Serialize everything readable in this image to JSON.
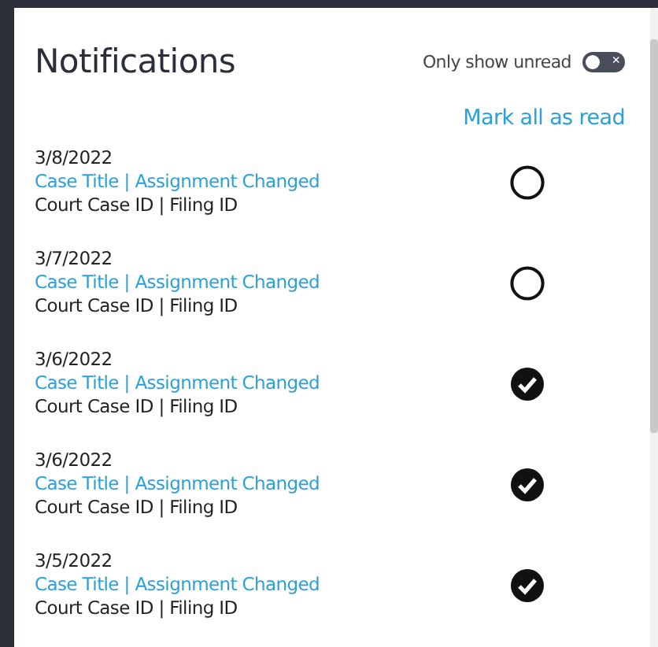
{
  "header": {
    "title": "Notifications",
    "toggle": {
      "label": "Only show unread",
      "on": false,
      "off_glyph": "×"
    }
  },
  "mark_all": "Mark all as read",
  "notifications": [
    {
      "date": "3/8/2022",
      "title": "Case Title | Assignment Changed",
      "detail": "Court Case ID | Filing ID",
      "read": false
    },
    {
      "date": "3/7/2022",
      "title": "Case Title | Assignment Changed",
      "detail": "Court Case ID | Filing ID",
      "read": false
    },
    {
      "date": "3/6/2022",
      "title": "Case Title | Assignment Changed",
      "detail": "Court Case ID | Filing ID",
      "read": true
    },
    {
      "date": "3/6/2022",
      "title": "Case Title | Assignment Changed",
      "detail": "Court Case ID | Filing ID",
      "read": true
    },
    {
      "date": "3/5/2022",
      "title": "Case Title | Assignment Changed",
      "detail": "Court Case ID | Filing ID",
      "read": true
    }
  ]
}
